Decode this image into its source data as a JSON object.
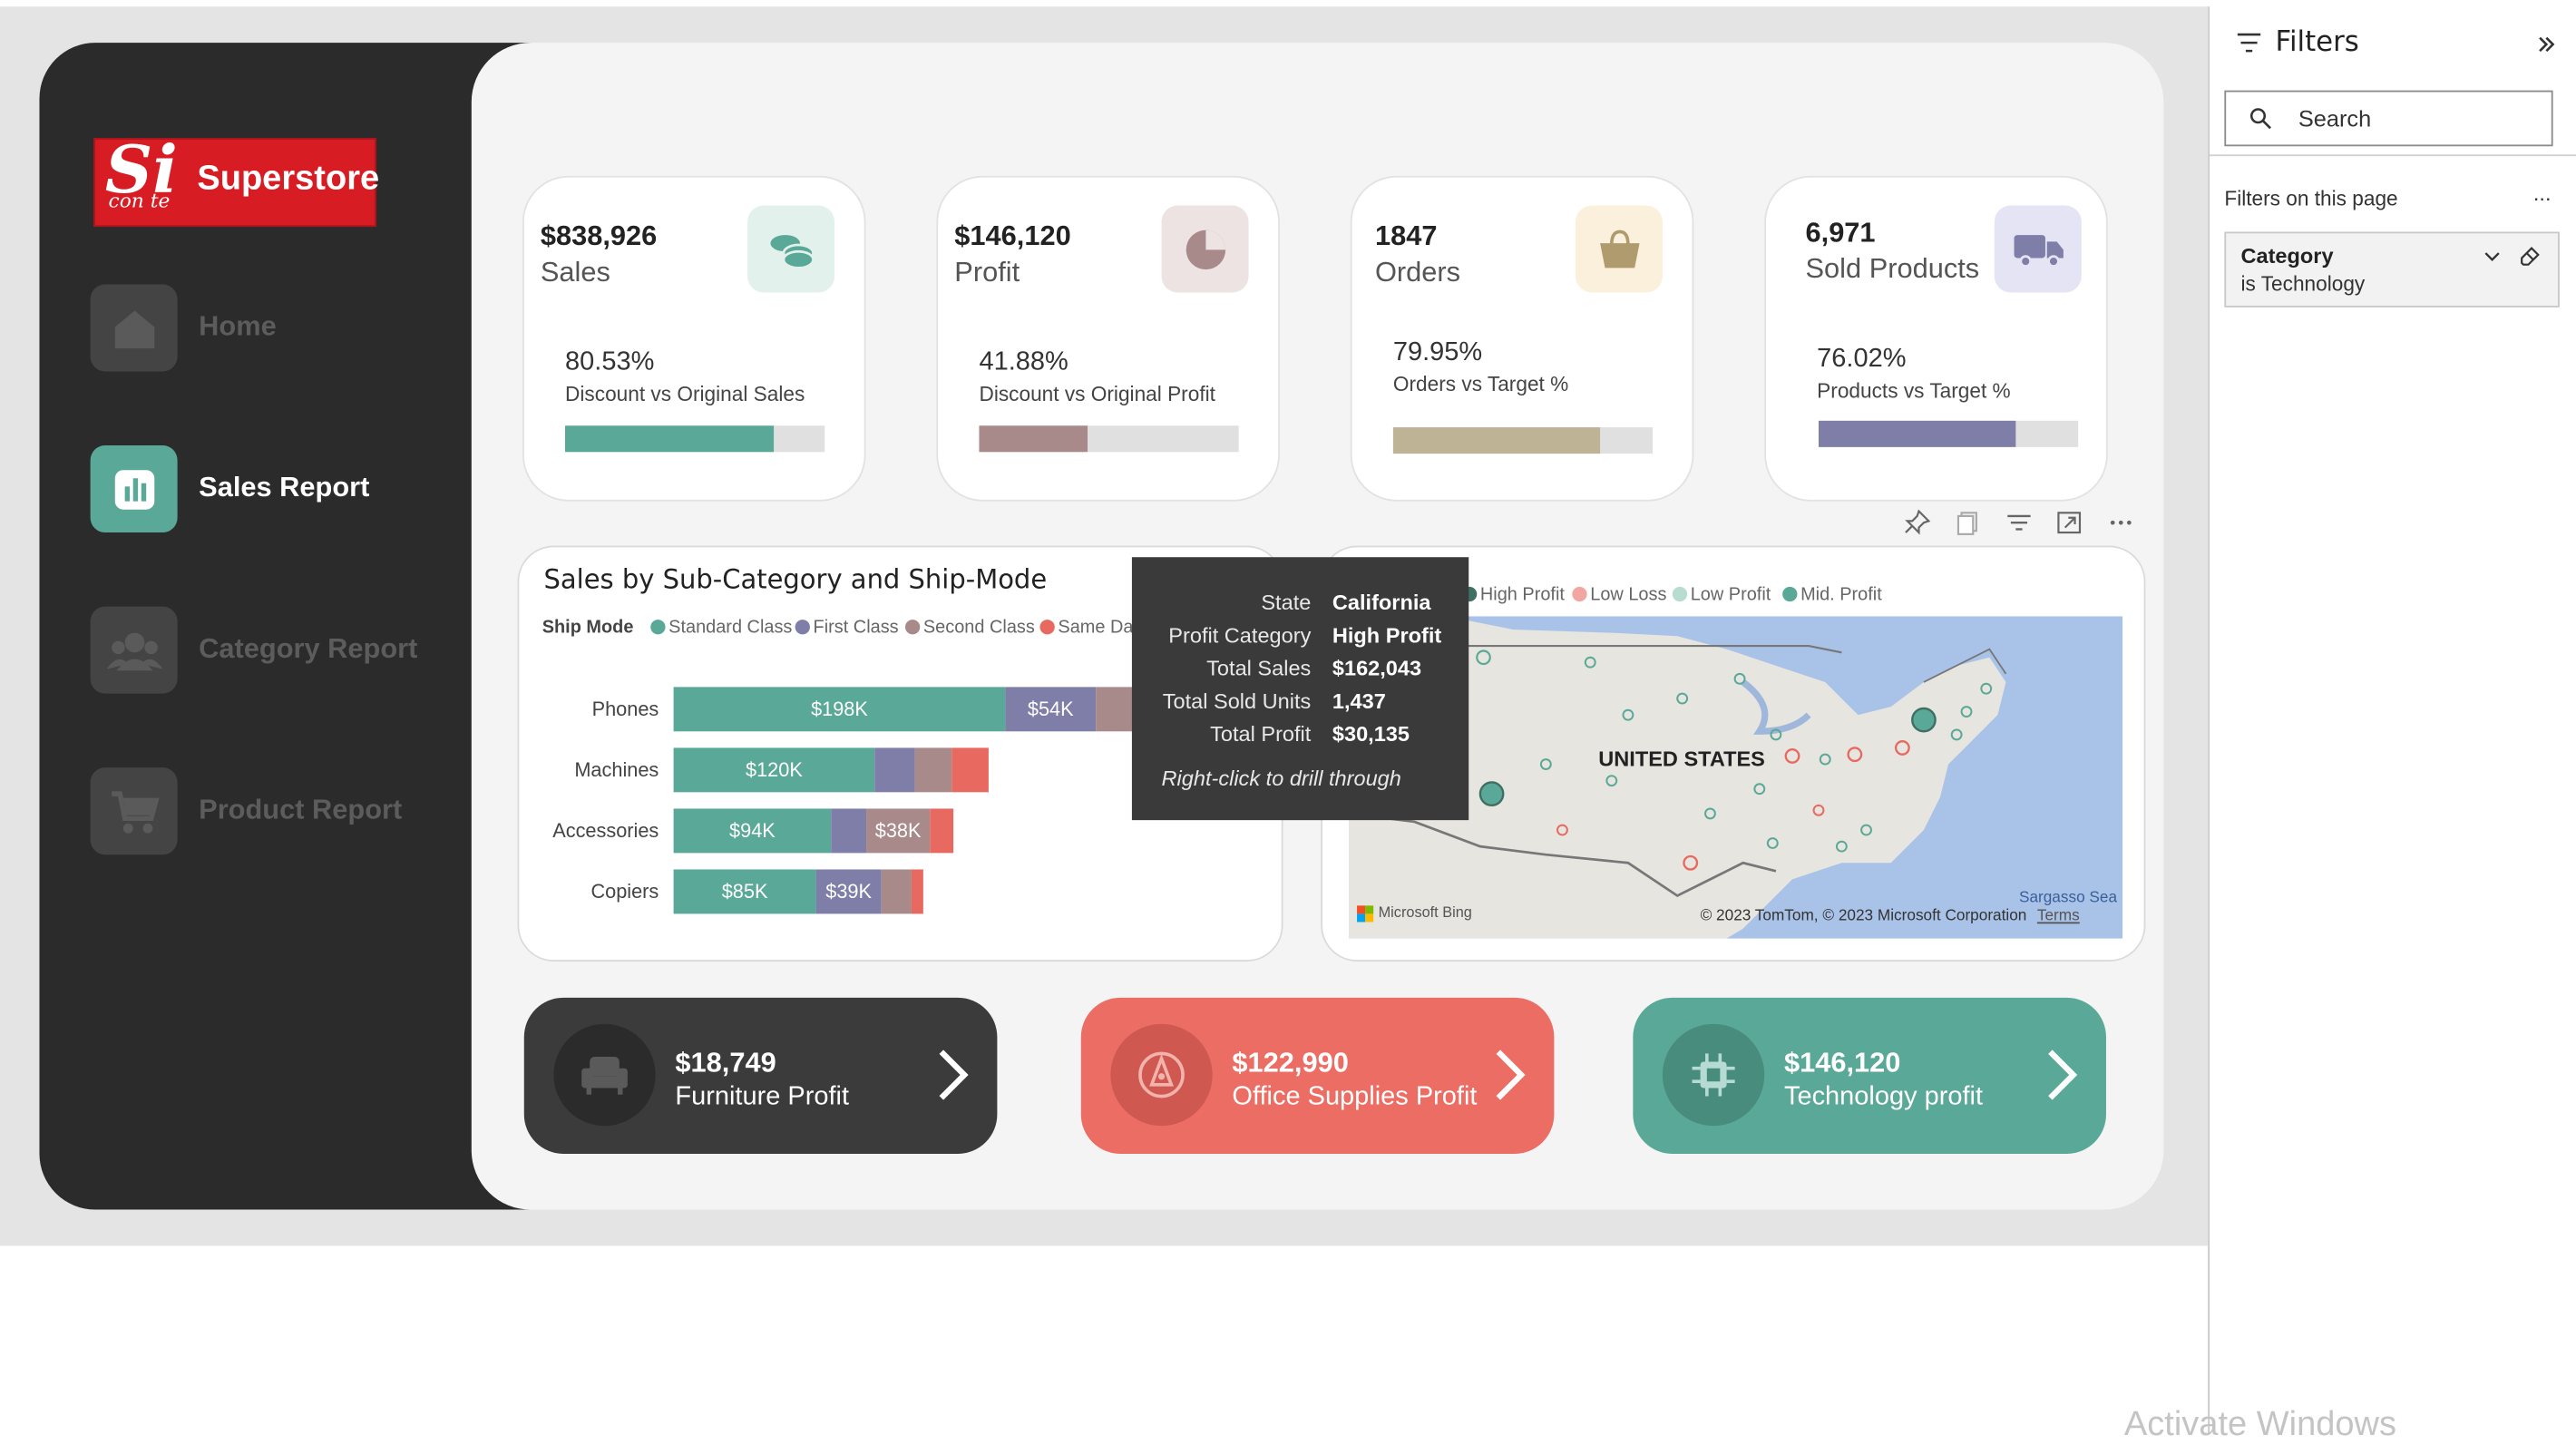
{
  "brand": {
    "logo_main": "Si",
    "logo_sub": "con te",
    "logo_name": "Superstore"
  },
  "nav": [
    {
      "label": "Home",
      "icon": "home-icon",
      "active": false
    },
    {
      "label": "Sales Report",
      "icon": "bar-chart-icon",
      "active": true
    },
    {
      "label": "Category Report",
      "icon": "users-icon",
      "active": false
    },
    {
      "label": "Product Report",
      "icon": "cart-icon",
      "active": false
    }
  ],
  "kpis": [
    {
      "value": "$838,926",
      "label": "Sales",
      "pct": "80.53%",
      "sub": "Discount vs Original Sales",
      "progress": 0.8053,
      "bar_color": "#5aa897",
      "icon": "coins-icon",
      "icon_bg": "#e3f1ed",
      "icon_color": "#5aa897"
    },
    {
      "value": "$146,120",
      "label": "Profit",
      "pct": "41.88%",
      "sub": "Discount vs Original Profit",
      "progress": 0.4188,
      "bar_color": "#a98a8a",
      "icon": "pie-icon",
      "icon_bg": "#ede3e3",
      "icon_color": "#a98a8a"
    },
    {
      "value": "1847",
      "label": "Orders",
      "pct": "79.95%",
      "sub": "Orders vs Target %",
      "progress": 0.7995,
      "bar_color": "#beb394",
      "icon": "basket-icon",
      "icon_bg": "#fbf0dc",
      "icon_color": "#b09b6e"
    },
    {
      "value": "6,971",
      "label": "Sold Products",
      "pct": "76.02%",
      "sub": "Products vs Target %",
      "progress": 0.7602,
      "bar_color": "#7e7ea8",
      "icon": "truck-icon",
      "icon_bg": "#e4e4f4",
      "icon_color": "#7e7ea8"
    }
  ],
  "sales_chart": {
    "title": "Sales by Sub-Category and Ship-Mode",
    "legend_title": "Ship Mode",
    "legend_items": [
      {
        "name": "Standard Class",
        "color": "#5aa897"
      },
      {
        "name": "First Class",
        "color": "#7e7ea8"
      },
      {
        "name": "Second Class",
        "color": "#a98a8a"
      },
      {
        "name": "Same Day",
        "color": "#e8695f"
      }
    ]
  },
  "chart_data": {
    "type": "bar",
    "orientation": "horizontal",
    "stacked": true,
    "categories": [
      "Phones",
      "Machines",
      "Accessories",
      "Copiers"
    ],
    "series": [
      {
        "name": "Standard Class",
        "values": [
          198,
          120,
          94,
          85
        ],
        "labels": [
          "$198K",
          "$120K",
          "$94K",
          "$85K"
        ]
      },
      {
        "name": "First Class",
        "values": [
          54,
          24,
          21,
          39
        ],
        "labels": [
          "$54K",
          "",
          "",
          "$39K"
        ]
      },
      {
        "name": "Second Class",
        "values": [
          40,
          22,
          38,
          18
        ],
        "labels": [
          "",
          "",
          "$38K",
          ""
        ]
      },
      {
        "name": "Same Day",
        "values": [
          14,
          22,
          14,
          7
        ],
        "labels": [
          "",
          "",
          "",
          ""
        ]
      }
    ],
    "title": "Sales by Sub-Category and Ship-Mode",
    "xlabel": "",
    "ylabel": "",
    "value_units": "thousands of dollars"
  },
  "map": {
    "legend_items": [
      {
        "name": "High Profit",
        "color": "#3f6f62"
      },
      {
        "name": "Low Loss",
        "color": "#f2a6a1"
      },
      {
        "name": "Low Profit",
        "color": "#b8dccf"
      },
      {
        "name": "Mid. Profit",
        "color": "#5aa897"
      }
    ],
    "country_label": "UNITED STATES",
    "attribution": "© 2023 TomTom, © 2023 Microsoft Corporation",
    "terms": "Terms",
    "provider": "Microsoft Bing",
    "sea_label": "Sargasso Sea"
  },
  "tooltip": {
    "rows": [
      {
        "key": "State",
        "value": "California"
      },
      {
        "key": "Profit Category",
        "value": "High Profit"
      },
      {
        "key": "Total Sales",
        "value": "$162,043"
      },
      {
        "key": "Total Sold Units",
        "value": "1,437"
      },
      {
        "key": "Total Profit",
        "value": "$30,135"
      }
    ],
    "hint": "Right-click to drill through"
  },
  "category_cards": [
    {
      "value": "$18,749",
      "label": "Furniture Profit",
      "bg": "#3b3b3b",
      "circle": "#2b2b2b",
      "icon": "armchair-icon"
    },
    {
      "value": "$122,990",
      "label": "Office Supplies Profit",
      "bg": "#ec6d64",
      "circle": "#cf5851",
      "icon": "pencil-icon"
    },
    {
      "value": "$146,120",
      "label": "Technology profit",
      "bg": "#5aa897",
      "circle": "#478c7d",
      "icon": "chip-icon"
    }
  ],
  "filters": {
    "title": "Filters",
    "search_placeholder": "Search",
    "section": "Filters on this page",
    "more": "...",
    "card": {
      "name": "Category",
      "value": "is Technology"
    }
  },
  "watermark": "Activate Windows"
}
